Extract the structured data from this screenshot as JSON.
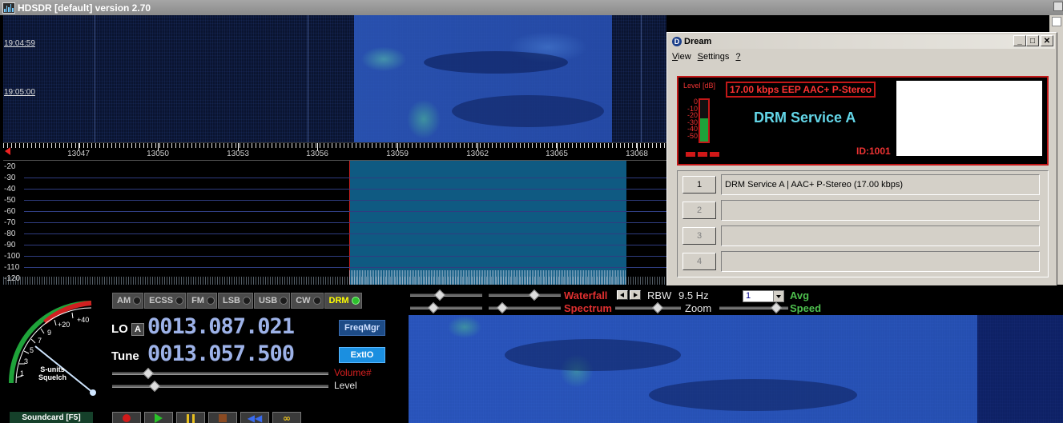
{
  "main_window": {
    "title": "HDSDR [default]  version 2.70"
  },
  "waterfall": {
    "timestamps": [
      "19:04:59",
      "19:05:00"
    ]
  },
  "frequency_scale": {
    "labels": [
      "13047",
      "13050",
      "13053",
      "13056",
      "13059",
      "13062",
      "13065",
      "13068"
    ]
  },
  "spectrum": {
    "db_labels": [
      "-20",
      "-30",
      "-40",
      "-50",
      "-60",
      "-70",
      "-80",
      "-90",
      "-100",
      "-110",
      "-120"
    ]
  },
  "dream": {
    "title": "Dream",
    "menu": [
      "View",
      "Settings",
      "?"
    ],
    "level_label": "Level [dB]",
    "level_scale": [
      "0",
      "-10",
      "-20",
      "-30",
      "-40",
      "-50"
    ],
    "level_fill_fraction": 0.55,
    "rate_text": "17.00 kbps EEP  AAC+  P-Stereo",
    "service_name": "DRM Service A",
    "service_id": "ID:1001",
    "services": [
      {
        "number": "1",
        "text": "DRM Service A  |  AAC+ P-Stereo (17.00 kbps)"
      },
      {
        "number": "2",
        "text": ""
      },
      {
        "number": "3",
        "text": ""
      },
      {
        "number": "4",
        "text": ""
      }
    ],
    "colors": {
      "display_border": "#c21818",
      "service_text": "#63d6e8",
      "meter_fill": "#1fa33a"
    }
  },
  "gauge": {
    "scale_labels": [
      "1",
      "3",
      "5",
      "7",
      "9",
      "+20",
      "+40"
    ],
    "caption_line1": "S-units",
    "caption_line2": "Squelch"
  },
  "soundcard_button": "Soundcard  [F5]",
  "modes": [
    {
      "label": "AM",
      "active": false
    },
    {
      "label": "ECSS",
      "active": false
    },
    {
      "label": "FM",
      "active": false
    },
    {
      "label": "LSB",
      "active": false
    },
    {
      "label": "USB",
      "active": false
    },
    {
      "label": "CW",
      "active": false
    },
    {
      "label": "DRM",
      "active": true
    }
  ],
  "lo": {
    "label": "LO",
    "button": "A",
    "value": "0013.087.021"
  },
  "tune": {
    "label": "Tune",
    "value": "0013.057.500"
  },
  "buttons": {
    "freqmgr": "FreqMgr",
    "extio": "ExtIO"
  },
  "sliders": {
    "volume_label": "Volume#",
    "level_label": "Level"
  },
  "controls": {
    "waterfall_label": "Waterfall",
    "spectrum_label": "Spectrum",
    "rbw_label": "RBW",
    "rbw_value": "9.5 Hz",
    "zoom_label": "Zoom",
    "avg_value": "1",
    "avg_label": "Avg",
    "speed_label": "Speed"
  }
}
